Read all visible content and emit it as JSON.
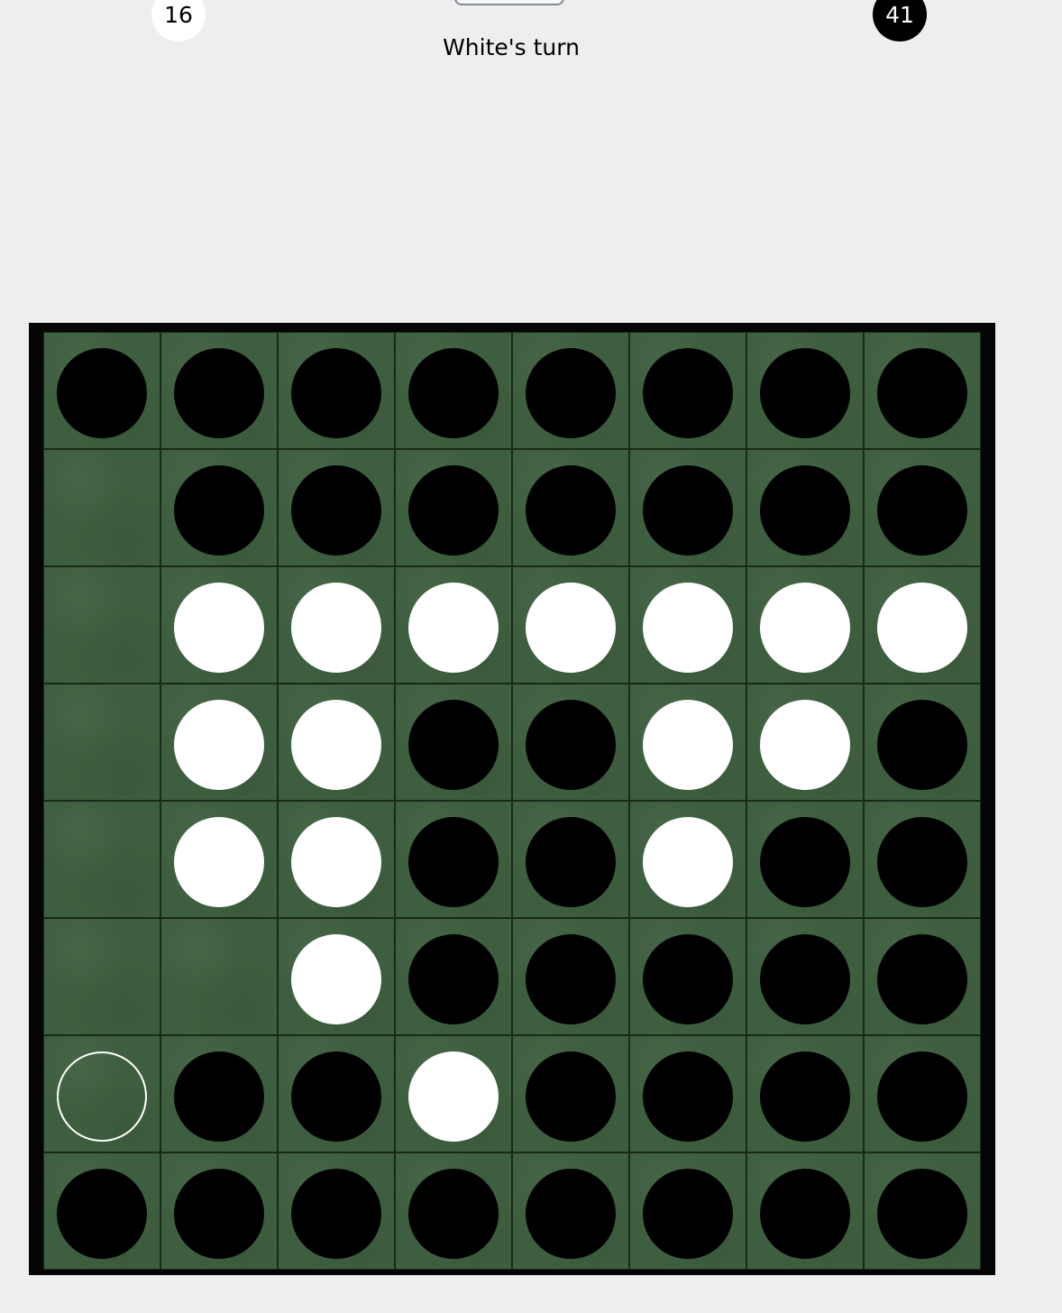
{
  "scores": {
    "white": "16",
    "black": "41"
  },
  "status": {
    "turn_text": "White's turn"
  },
  "colors": {
    "board_green": "#3e5f3f",
    "frame": "#050505",
    "black_disc": "#000000",
    "white_disc": "#ffffff",
    "background": "#eeeeee"
  },
  "board": [
    [
      "B",
      "B",
      "B",
      "B",
      "B",
      "B",
      "B",
      "B"
    ],
    [
      "",
      "B",
      "B",
      "B",
      "B",
      "B",
      "B",
      "B"
    ],
    [
      "",
      "W",
      "W",
      "W",
      "W",
      "W",
      "W",
      "W"
    ],
    [
      "",
      "W",
      "W",
      "B",
      "B",
      "W",
      "W",
      "B"
    ],
    [
      "",
      "W",
      "W",
      "B",
      "B",
      "W",
      "B",
      "B"
    ],
    [
      "",
      "",
      "W",
      "B",
      "B",
      "B",
      "B",
      "B"
    ],
    [
      "H",
      "B",
      "B",
      "W",
      "B",
      "B",
      "B",
      "B"
    ],
    [
      "B",
      "B",
      "B",
      "B",
      "B",
      "B",
      "B",
      "B"
    ]
  ]
}
